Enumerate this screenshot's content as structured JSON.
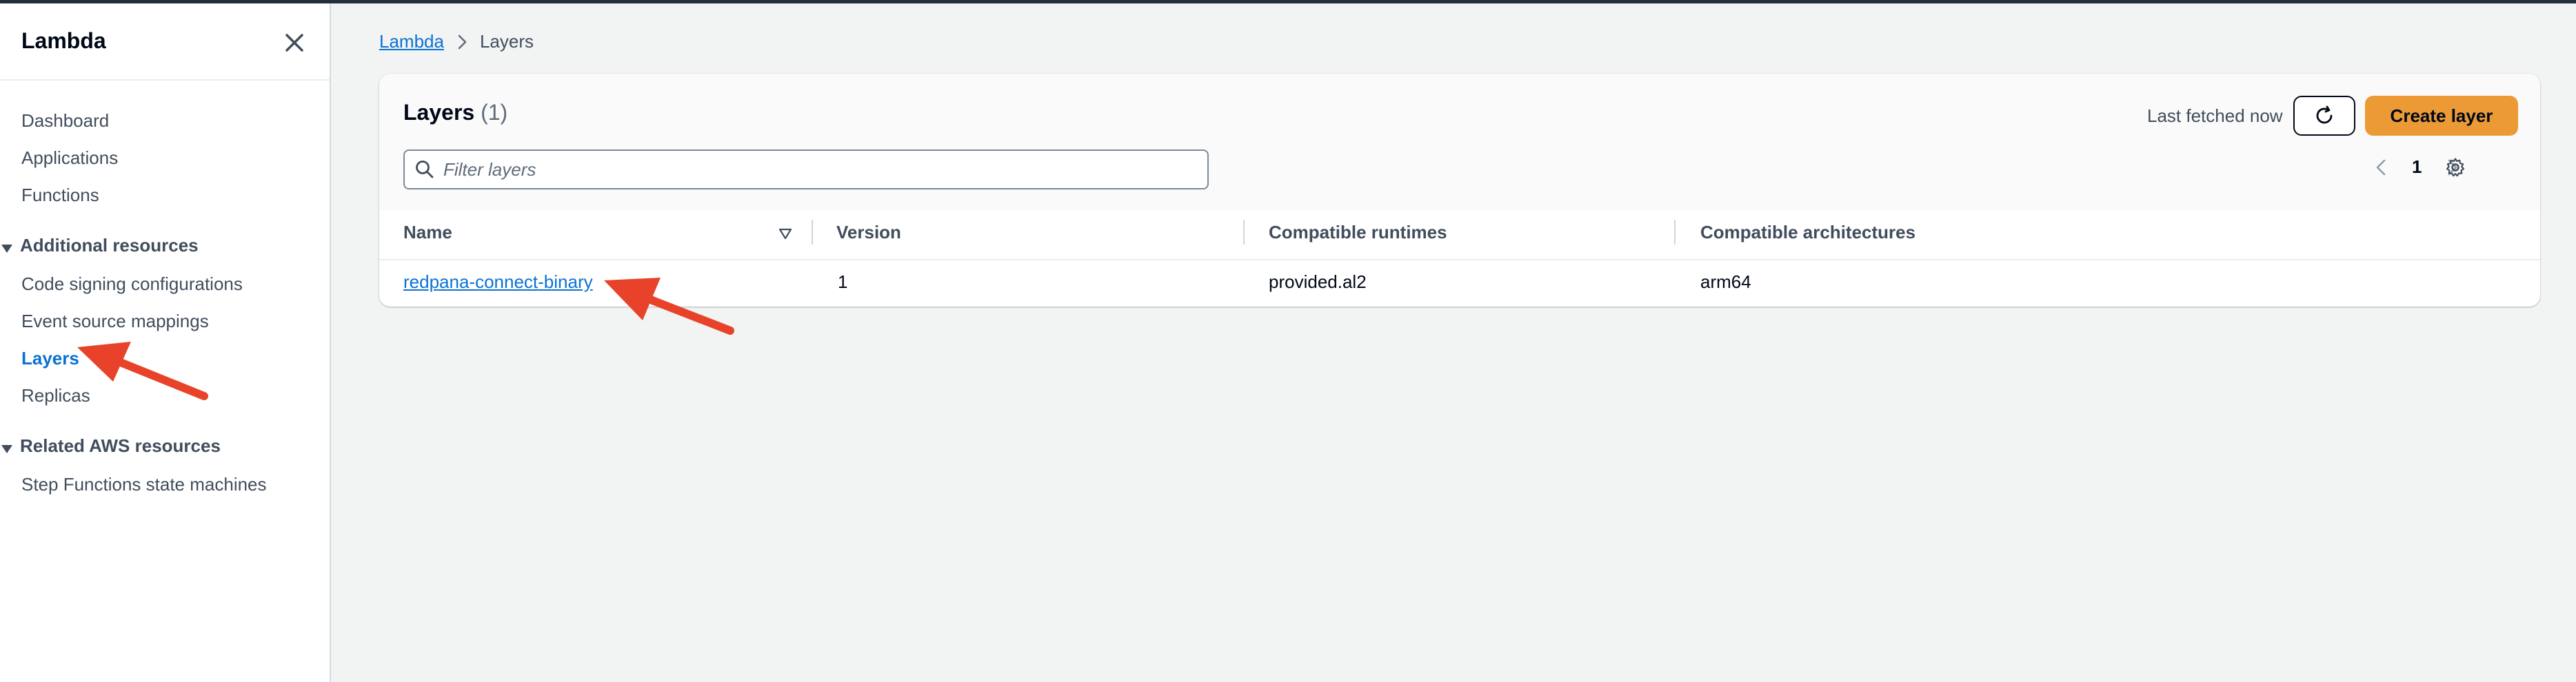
{
  "sidebar": {
    "title": "Lambda",
    "items": [
      {
        "label": "Dashboard"
      },
      {
        "label": "Applications"
      },
      {
        "label": "Functions"
      }
    ],
    "sections": [
      {
        "label": "Additional resources",
        "items": [
          {
            "label": "Code signing configurations"
          },
          {
            "label": "Event source mappings"
          },
          {
            "label": "Layers"
          },
          {
            "label": "Replicas"
          }
        ]
      },
      {
        "label": "Related AWS resources",
        "items": [
          {
            "label": "Step Functions state machines"
          }
        ]
      }
    ]
  },
  "breadcrumb": {
    "root": "Lambda",
    "current": "Layers"
  },
  "panel": {
    "title": "Layers",
    "count": "(1)",
    "last_fetched": "Last fetched now",
    "create_label": "Create layer",
    "filter_placeholder": "Filter layers",
    "page": "1",
    "columns": [
      "Name",
      "Version",
      "Compatible runtimes",
      "Compatible architectures"
    ],
    "rows": [
      {
        "name": "redpana-connect-binary",
        "version": "1",
        "runtimes": "provided.al2",
        "architectures": "arm64"
      }
    ]
  },
  "colors": {
    "accent": "#0972d3",
    "primary_button": "#ec9a36",
    "annotation_arrow": "#e8432a"
  },
  "icons": [
    "close-icon",
    "caret-down-icon",
    "chevron-right-icon",
    "refresh-icon",
    "search-icon",
    "chevron-left-icon",
    "settings-icon",
    "sort-down-icon",
    "arrow-annotation"
  ]
}
